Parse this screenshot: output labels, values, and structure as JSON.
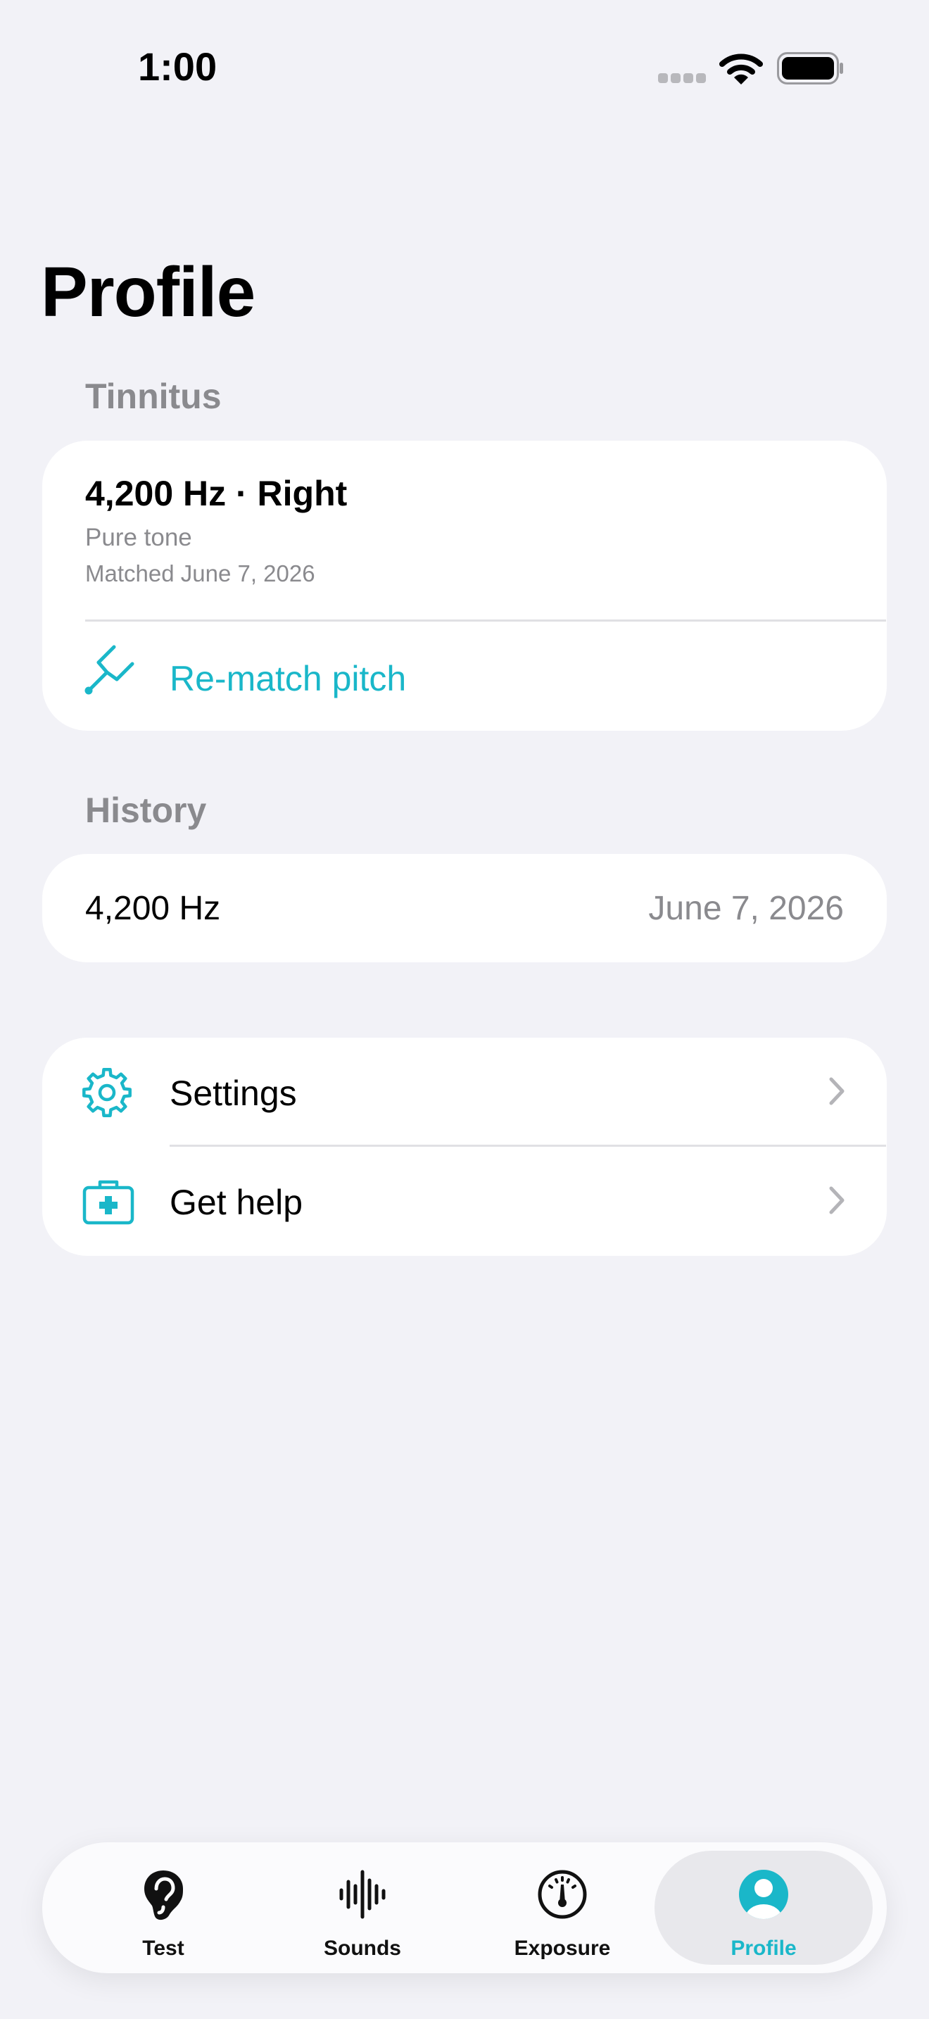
{
  "status_bar": {
    "time": "1:00"
  },
  "page": {
    "title": "Profile"
  },
  "tinnitus": {
    "header": "Tinnitus",
    "title": "4,200 Hz · Right",
    "subtitle": "Pure tone",
    "matched": "Matched June 7, 2026",
    "rematch_label": "Re-match pitch"
  },
  "history": {
    "header": "History",
    "items": [
      {
        "frequency": "4,200 Hz",
        "date": "June 7, 2026"
      }
    ]
  },
  "menu": {
    "settings_label": "Settings",
    "help_label": "Get help"
  },
  "tabs": [
    {
      "label": "Test",
      "icon": "ear-icon",
      "active": false
    },
    {
      "label": "Sounds",
      "icon": "waveform-icon",
      "active": false
    },
    {
      "label": "Exposure",
      "icon": "gauge-icon",
      "active": false
    },
    {
      "label": "Profile",
      "icon": "person-circle-icon",
      "active": true
    }
  ],
  "colors": {
    "accent": "#1ab7c9",
    "background": "#f2f2f7",
    "secondary_text": "#8a8a8e"
  }
}
